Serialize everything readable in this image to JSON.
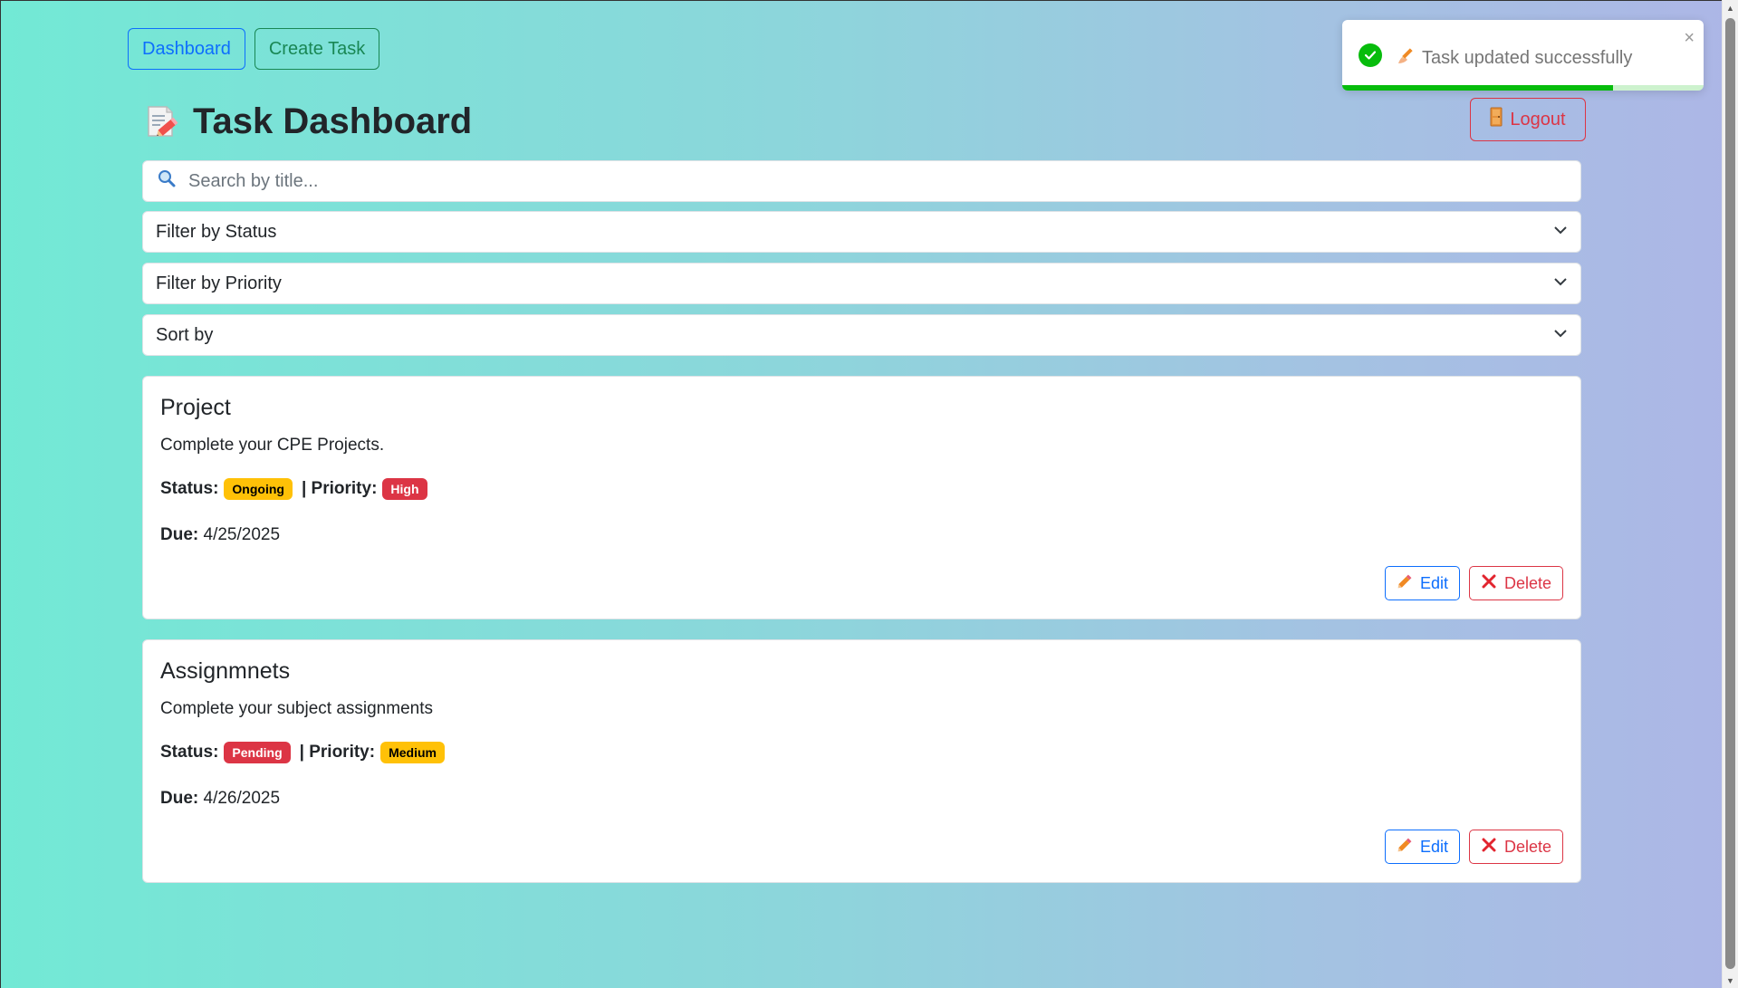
{
  "nav": {
    "dashboard_label": "Dashboard",
    "create_task_label": "Create Task"
  },
  "header": {
    "title": "Task Dashboard",
    "title_icon": "memo-icon",
    "logout_label": "Logout"
  },
  "search": {
    "placeholder": "Search by title...",
    "value": ""
  },
  "filters": {
    "status": "Filter by Status",
    "priority": "Filter by Priority",
    "sort": "Sort by"
  },
  "labels": {
    "status": "Status:",
    "priority": "| Priority:",
    "due": "Due:",
    "edit": "Edit",
    "delete": "Delete"
  },
  "tasks": [
    {
      "title": "Project",
      "description": "Complete your CPE Projects.",
      "status": "Ongoing",
      "priority": "High",
      "due": "4/25/2025"
    },
    {
      "title": "Assignmnets",
      "description": "Complete your subject assignments",
      "status": "Pending",
      "priority": "Medium",
      "due": "4/26/2025"
    }
  ],
  "toast": {
    "message": "Task updated successfully",
    "icon": "check-circle-icon",
    "progress": 0.75
  },
  "colors": {
    "primary": "#0d6efd",
    "success": "#198754",
    "danger": "#dc3545",
    "warning": "#ffc107",
    "toast_green": "#07bc0c"
  }
}
